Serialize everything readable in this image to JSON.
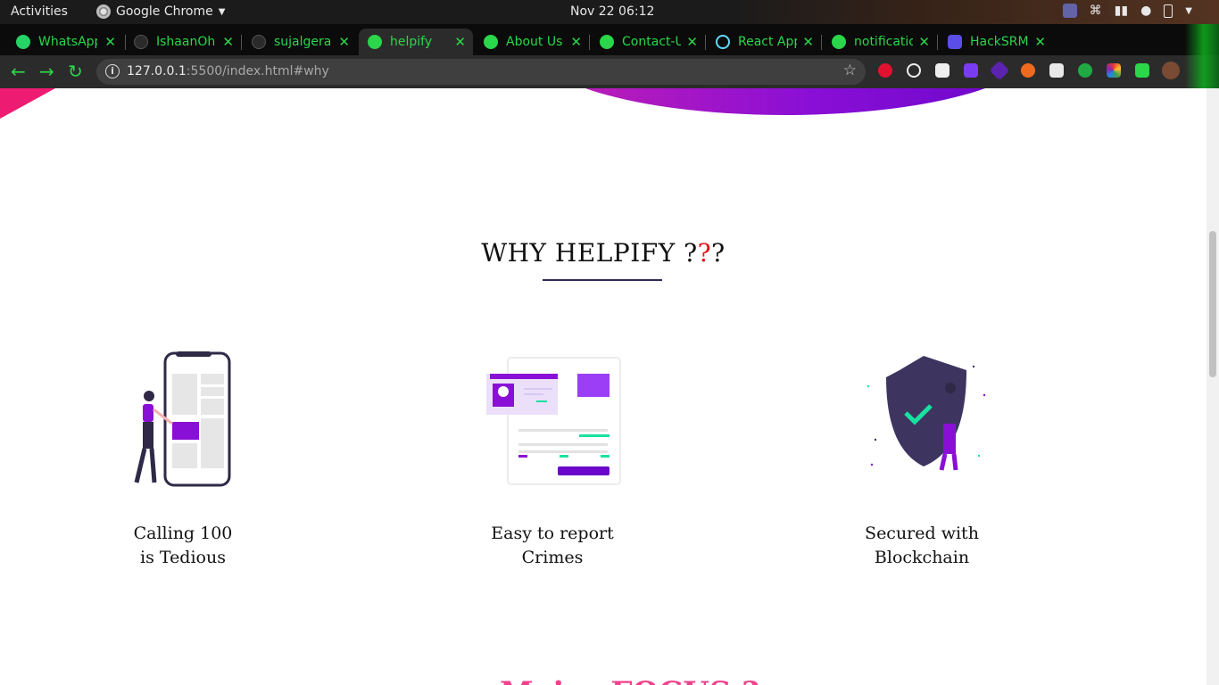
{
  "system": {
    "activities": "Activities",
    "app_name": "Google Chrome",
    "clock": "Nov 22  06:12"
  },
  "tabs": [
    {
      "label": "WhatsApp",
      "icon": "whatsapp-icon",
      "color": "#25d366"
    },
    {
      "label": "IshaanOh",
      "icon": "github-icon",
      "color": "#222222"
    },
    {
      "label": "sujalgera",
      "icon": "github-icon",
      "color": "#222222"
    },
    {
      "label": "helpify",
      "icon": "globe-icon",
      "color": "#2ad64a"
    },
    {
      "label": "About Us",
      "icon": "globe-icon",
      "color": "#2ad64a"
    },
    {
      "label": "Contact-U",
      "icon": "globe-icon",
      "color": "#2ad64a"
    },
    {
      "label": "React App",
      "icon": "react-icon",
      "color": "#61dafb"
    },
    {
      "label": "notificatio",
      "icon": "globe-icon",
      "color": "#2ad64a"
    },
    {
      "label": "HackSRM",
      "icon": "hacksrm-icon",
      "color": "#5b4ee8"
    }
  ],
  "toolbar": {
    "url_host": "127.0.0.1",
    "url_rest": ":5500/index.html#why"
  },
  "page": {
    "heading_main": "WHY HELPIFY ",
    "heading_q1": "?",
    "heading_q2": "?",
    "heading_q3": "?",
    "features": [
      {
        "line1": "Calling 100",
        "line2": "is Tedious"
      },
      {
        "line1": "Easy to report",
        "line2": "Crimes"
      },
      {
        "line1": "Secured with",
        "line2": "Blockchain"
      }
    ],
    "next_section_title": "Major FOCUS ?"
  },
  "colors": {
    "accent_purple": "#8a0fd6",
    "accent_pink": "#ee1b72",
    "chrome_green": "#2ad64a"
  }
}
